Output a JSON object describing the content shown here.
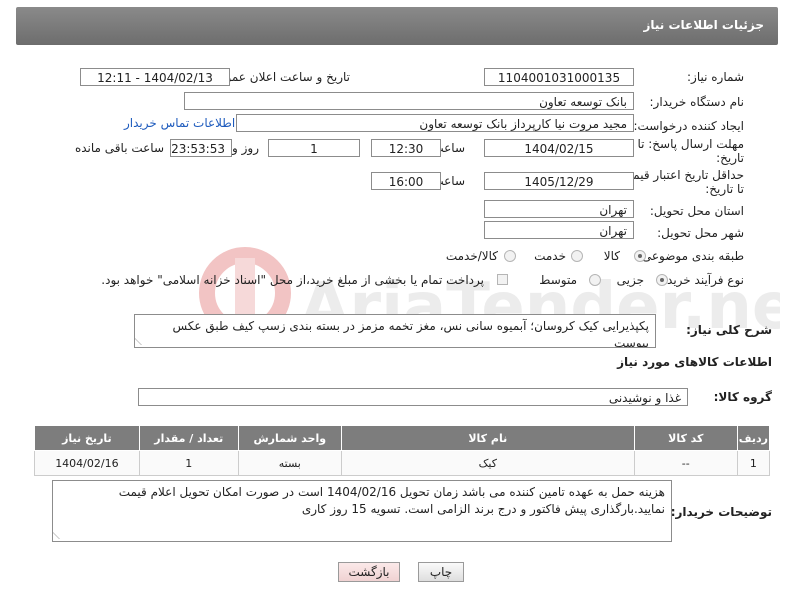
{
  "header": {
    "title": "جزئیات اطلاعات نیاز"
  },
  "fields": {
    "need_number_label": "شماره نیاز:",
    "need_number": "1104001031000135",
    "announce_label": "تاریخ و ساعت اعلان عمومی:",
    "announce_value": "1404/02/13 - 12:11",
    "buyer_org_label": "نام دستگاه خریدار:",
    "buyer_org": "بانک توسعه تعاون",
    "creator_label": "ایجاد کننده درخواست:",
    "creator": "مجید مروت نیا کارپرداز بانک توسعه تعاون",
    "contact_link": "اطلاعات تماس خریدار",
    "deadline_label_1": "مهلت ارسال پاسخ: تا",
    "deadline_label_2": "تاریخ:",
    "deadline_date": "1404/02/15",
    "time_label": "ساعت",
    "deadline_time": "12:30",
    "days_value": "1",
    "days_label": "روز و",
    "remaining_value": "23:53:53",
    "remaining_label": "ساعت باقی مانده",
    "validity_label_1": "حداقل تاریخ اعتبار قیمت:",
    "validity_label_2": "تا تاریخ:",
    "validity_date": "1405/12/29",
    "validity_time": "16:00",
    "province_label": "استان محل تحویل:",
    "province": "تهران",
    "city_label": "شهر محل تحویل:",
    "city": "تهران",
    "category_label": "طبقه بندی موضوعی:",
    "category_options": [
      "کالا",
      "خدمت",
      "کالا/خدمت"
    ],
    "process_label": "نوع فرآیند خرید :",
    "process_options": [
      "جزیی",
      "متوسط"
    ],
    "payment_note": "پرداخت تمام یا بخشی از مبلغ خرید،از محل \"اسناد خزانه اسلامی\" خواهد بود."
  },
  "description": {
    "label": "شرح کلی نیاز:",
    "text": "پکپذیرایی کیک کروسان؛ آبمیوه سانی نس، مغز تخمه مزمز در بسته بندی زسپ کیف طبق عکس پیوست"
  },
  "goods": {
    "section_title": "اطلاعات کالاهای مورد نیاز",
    "group_label": "گروه کالا:",
    "group_value": "غذا و نوشیدنی",
    "columns": [
      "ردیف",
      "کد کالا",
      "نام کالا",
      "واحد شمارش",
      "تعداد / مقدار",
      "تاریخ نیاز"
    ],
    "rows": [
      {
        "row": "1",
        "code": "--",
        "name": "کیک",
        "unit": "بسته",
        "qty": "1",
        "date": "1404/02/16"
      }
    ]
  },
  "buyer_notes": {
    "label": "توضیحات خریدار:",
    "text": "هزینه حمل به عهده تامین کننده می باشد زمان تحویل 1404/02/16 است در صورت امکان تحویل اعلام قیمت نمایید.بارگذاری پیش فاکتور و درج برند الزامی است. تسویه 15 روز کاری"
  },
  "buttons": {
    "print": "چاپ",
    "back": "بازگشت"
  },
  "watermark_text": "AriaTender.neT",
  "colors": {
    "header": "#7a7a7a",
    "link": "#1e5bbd",
    "back_button": "#f6dede"
  }
}
